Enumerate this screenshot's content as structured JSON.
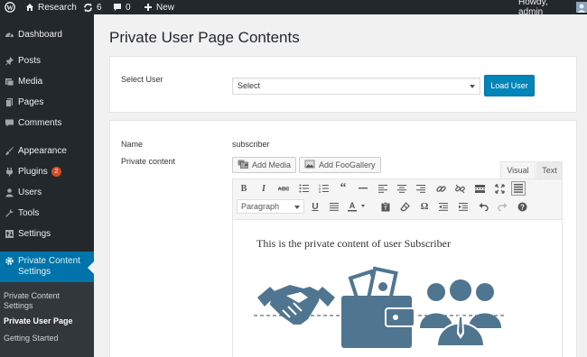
{
  "adminbar": {
    "site_name": "Research",
    "updates_count": "6",
    "comments_count": "0",
    "new_label": "New",
    "howdy": "Howdy, admin"
  },
  "sidebar": {
    "dashboard": "Dashboard",
    "posts": "Posts",
    "media": "Media",
    "pages": "Pages",
    "comments": "Comments",
    "appearance": "Appearance",
    "plugins": "Plugins",
    "plugins_badge": "2",
    "users": "Users",
    "tools": "Tools",
    "settings": "Settings",
    "active_line1": "Private Content",
    "active_line2": "Settings",
    "submenu": {
      "pcs_line1": "Private Content",
      "pcs_line2": "Settings",
      "private_user_page": "Private User Page",
      "getting_started": "Getting Started"
    }
  },
  "main": {
    "page_title": "Private User Page Contents",
    "select_user_label": "Select User",
    "select_value": "Select",
    "load_user_button": "Load User",
    "name_label": "Name",
    "name_value": "subscriber",
    "private_content_label": "Private content",
    "add_media": "Add Media",
    "add_foogallery": "Add FooGallery",
    "tab_visual": "Visual",
    "tab_text": "Text",
    "format_select": "Paragraph",
    "editor_text": "This is the private content of user Subscriber"
  },
  "colors": {
    "adminbar_bg": "#23282d",
    "sidebar_active": "#0073aa",
    "primary_button": "#0085ba",
    "illustration": "#4f7590",
    "badge": "#d54e21"
  }
}
